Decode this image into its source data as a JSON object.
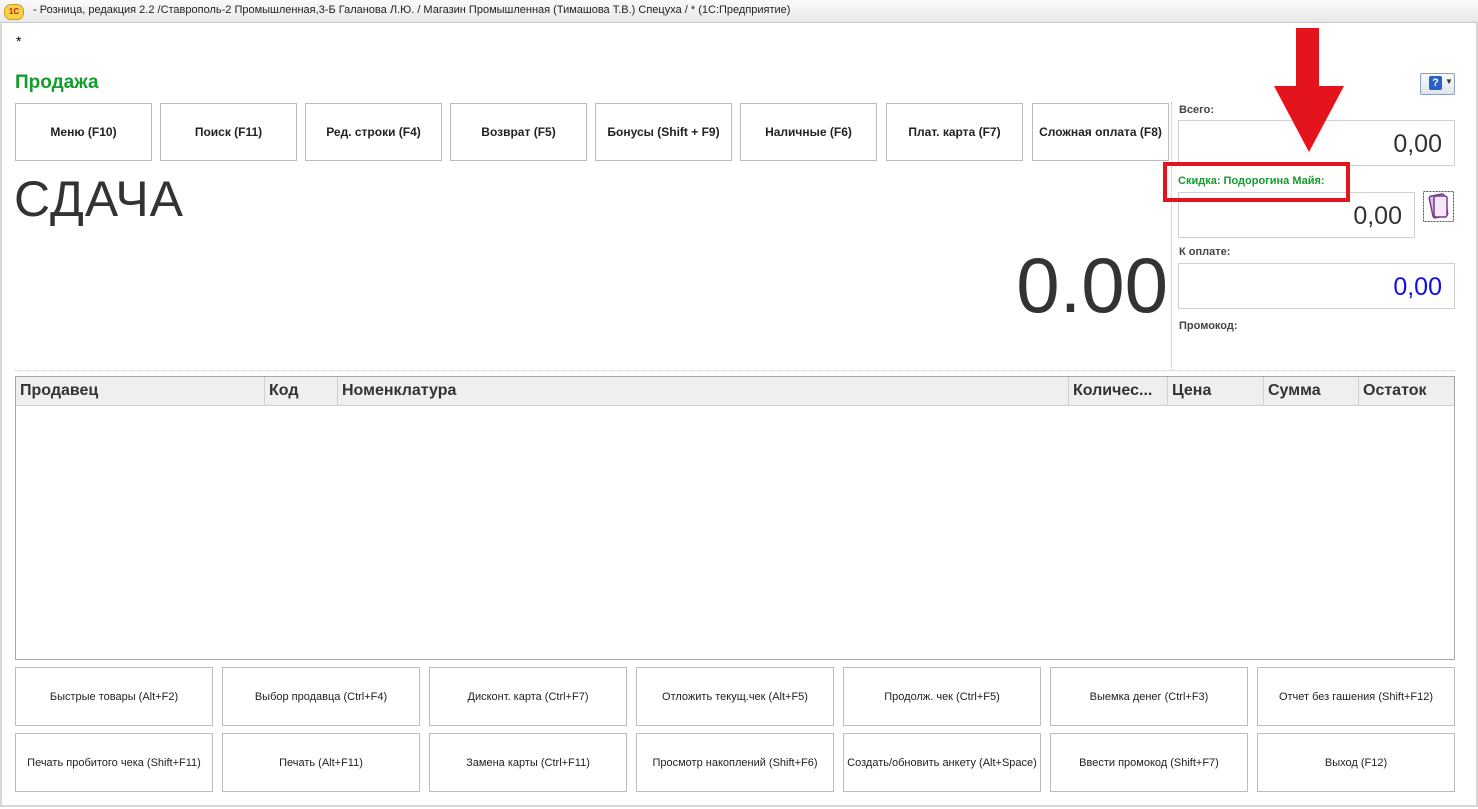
{
  "window": {
    "logo_text": "1С",
    "title": "- Розница, редакция 2.2 /Ставрополь-2 Промышленная,3-Б Галанова Л.Ю. / Магазин Промышленная (Тимашова Т.В.) Спецуха / *  (1С:Предприятие)"
  },
  "form": {
    "asterisk": "*",
    "title": "Продажа",
    "help_label": "?"
  },
  "top_buttons": [
    "Меню (F10)",
    "Поиск (F11)",
    "Ред. строки (F4)",
    "Возврат (F5)",
    "Бонусы (Shift + F9)",
    "Наличные (F6)",
    "Плат. карта (F7)",
    "Сложная оплата (F8)"
  ],
  "change": {
    "label": "СДАЧА",
    "amount": "0.00"
  },
  "totals": {
    "total_label": "Всего:",
    "total_value": "0,00",
    "discount_label": "Скидка: Подорогина Майя:",
    "discount_value": "0,00",
    "to_pay_label": "К оплате:",
    "to_pay_value": "0,00",
    "promo_label": "Промокод:"
  },
  "table": {
    "columns": [
      "Продавец",
      "Код",
      "Номенклатура",
      "Количес...",
      "Цена",
      "Сумма",
      "Остаток"
    ],
    "rows": []
  },
  "bottom_buttons_row1": [
    "Быстрые товары (Alt+F2)",
    "Выбор продавца (Ctrl+F4)",
    "Дисконт. карта (Ctrl+F7)",
    "Отложить текущ.чек (Alt+F5)",
    "Продолж. чек (Ctrl+F5)",
    "Выемка денег (Ctrl+F3)",
    "Отчет без гашения (Shift+F12)"
  ],
  "bottom_buttons_row2": [
    "Печать пробитого чека (Shift+F11)",
    "Печать (Alt+F11)",
    "Замена карты (Ctrl+F11)",
    "Просмотр накоплений (Shift+F6)",
    "Создать/обновить анкету (Alt+Space)",
    "Ввести промокод (Shift+F7)",
    "Выход (F12)"
  ],
  "colors": {
    "title_green": "#149c2c",
    "pay_blue": "#1010e0",
    "annotation_red": "#e3141e"
  },
  "icons": {
    "help": "help-icon",
    "discount_card": "discount-card-icon",
    "annotation_arrow": "down-arrow-annotation"
  }
}
